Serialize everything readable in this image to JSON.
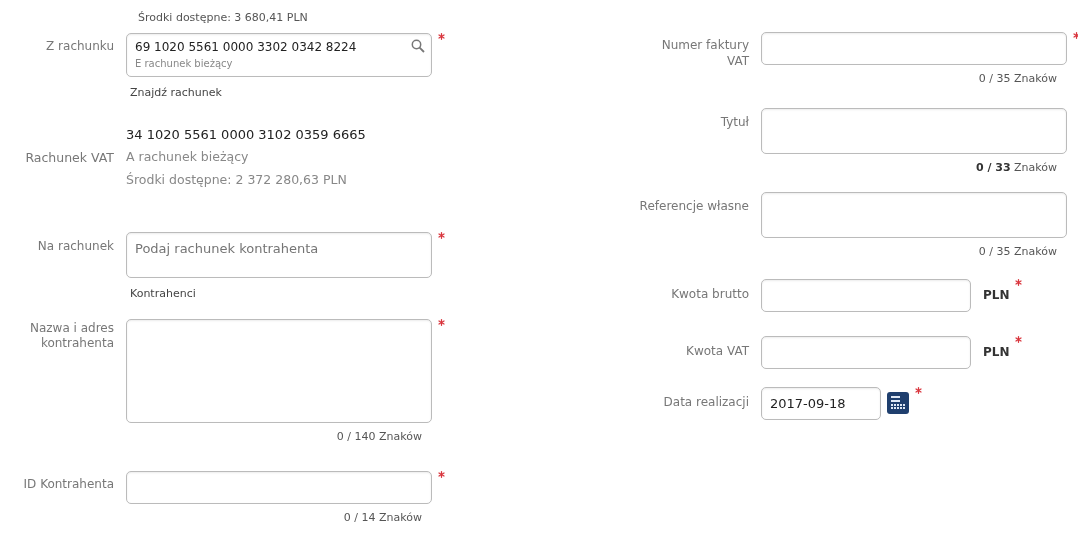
{
  "left_column": {
    "available_funds": "Środki dostępne: 3 680,41 PLN",
    "fields": [
      {
        "kind": "account_search",
        "label": "Z rachunku",
        "value": "69 1020 5561 0000 3302 0342 8224",
        "account_name": "E rachunek bieżący",
        "link": "Znajdź rachunek",
        "required": true
      },
      {
        "kind": "account_info",
        "label": "Rachunek VAT",
        "number": "34 1020 5561 0000 3102 0359 6665",
        "account_name": "A rachunek bieżący",
        "available_funds": "Środki dostępne: 2 372 280,63 PLN",
        "required": false
      },
      {
        "kind": "tall_input",
        "label": "Na rachunek",
        "placeholder": "Podaj rachunek kontrahenta",
        "link": "Kontrahenci",
        "required": true
      },
      {
        "kind": "textarea",
        "label": "Nazwa i adres kontrahenta",
        "counter": "0 / 140 Znaków",
        "required": true
      },
      {
        "kind": "input",
        "label": "ID Kontrahenta",
        "counter": "0 / 14 Znaków",
        "required": true
      }
    ]
  },
  "right_column": {
    "fields": [
      {
        "kind": "input",
        "label": "Numer faktury\nVAT",
        "counter": "0 / 35 Znaków",
        "required": true
      },
      {
        "kind": "tall_input",
        "label": "Tytuł",
        "counter": "**0 / 33** Znaków",
        "required": false
      },
      {
        "kind": "tall_input",
        "label": "Referencje własne",
        "counter": "0 / 35 Znaków",
        "required": false
      },
      {
        "kind": "amount",
        "label": "Kwota brutto",
        "currency": "PLN",
        "required": true
      },
      {
        "kind": "amount",
        "label": "Kwota VAT",
        "currency": "PLN",
        "required": true
      },
      {
        "kind": "date",
        "label": "Data realizacji",
        "value": "2017-09-18",
        "required": true
      }
    ]
  }
}
